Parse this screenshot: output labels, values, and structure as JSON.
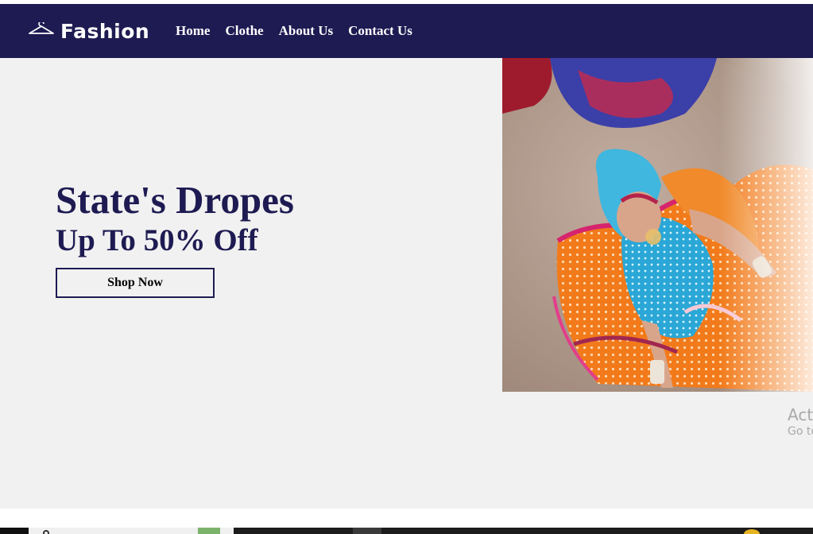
{
  "navbar": {
    "brand": "Fashion",
    "logo_icon": "hanger-icon",
    "links": [
      "Home",
      "Clothe",
      "About Us",
      "Contact Us"
    ]
  },
  "hero": {
    "title": "State's Dropes",
    "subtitle": "Up To 50% Off",
    "cta_label": "Shop Now",
    "image_icon": "model-in-orange-dress-photo"
  },
  "watermark": {
    "line1": "Acti",
    "line2": "Go to"
  },
  "taskbar": {
    "start_icon": "windows-start-icon",
    "search_icon": "search-icon"
  },
  "colors": {
    "brand_navy": "#1e1b52",
    "hero_bg": "#f1f1f1",
    "white": "#ffffff"
  }
}
